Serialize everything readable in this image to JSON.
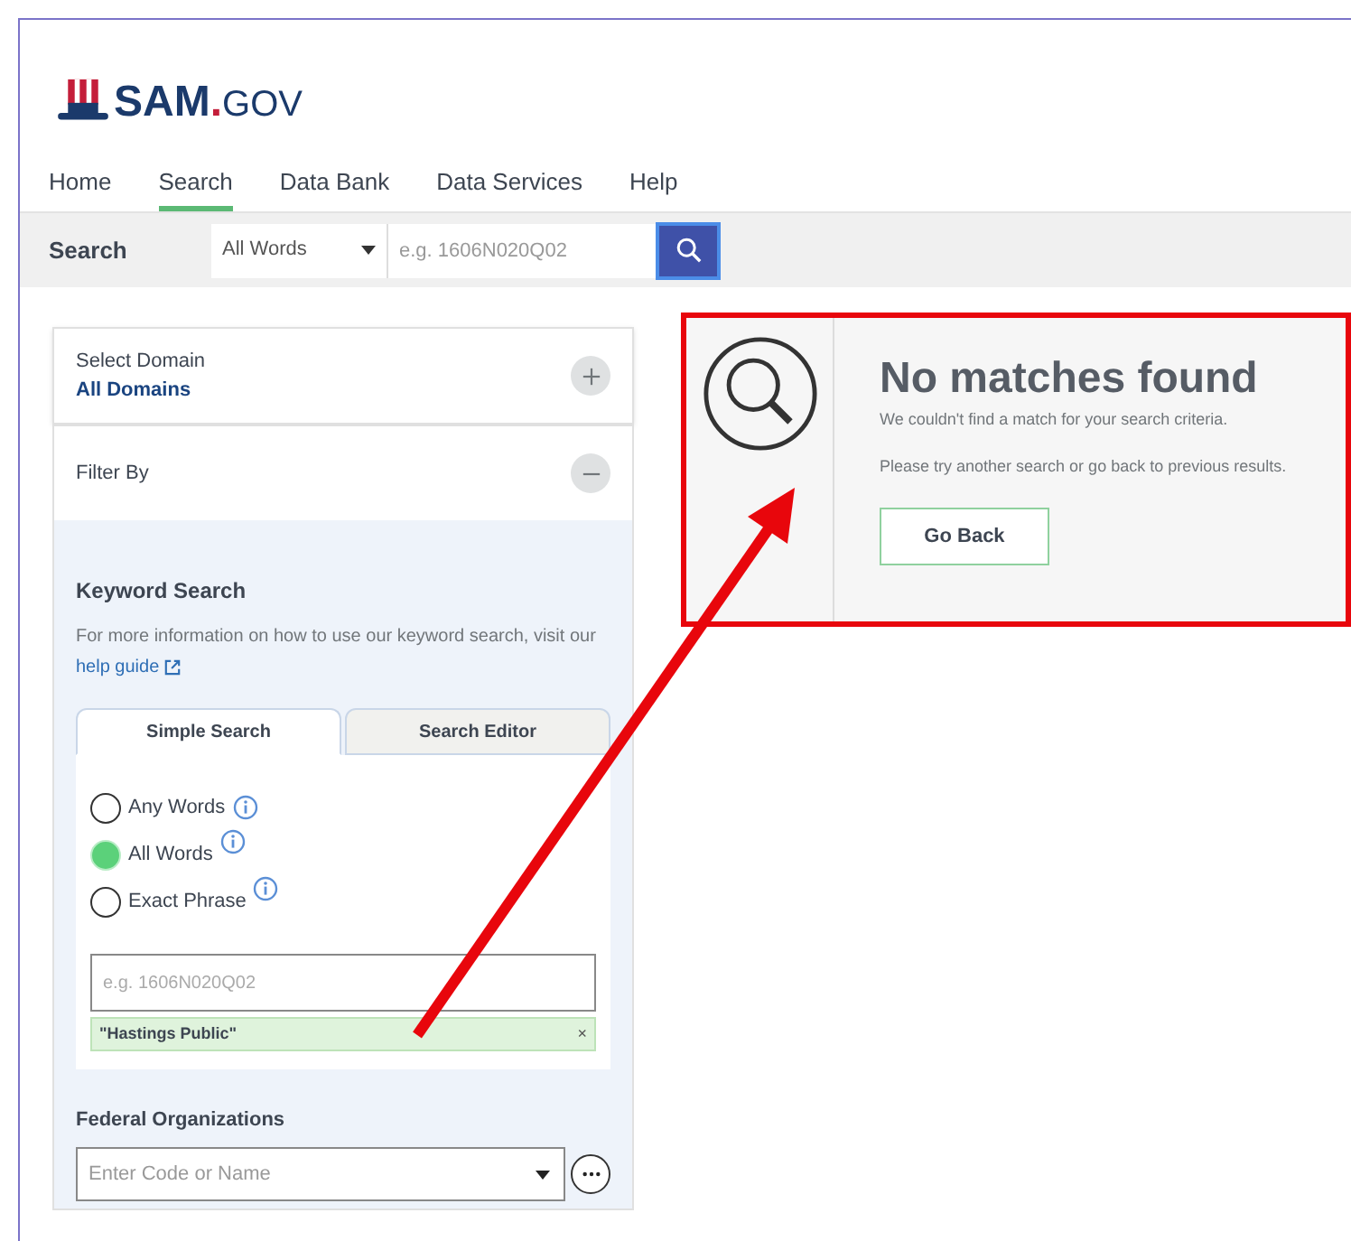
{
  "logo": {
    "name": "SAM",
    "suffix": ".GOV"
  },
  "nav": [
    {
      "label": "Home",
      "selected": false
    },
    {
      "label": "Search",
      "selected": true
    },
    {
      "label": "Data Bank",
      "selected": false
    },
    {
      "label": "Data Services",
      "selected": false
    },
    {
      "label": "Help",
      "selected": false
    }
  ],
  "search_bar": {
    "label": "Search",
    "mode": "All Words",
    "placeholder": "e.g. 1606N020Q02"
  },
  "sidebar": {
    "domain": {
      "label": "Select Domain",
      "value": "All Domains",
      "expanded": false
    },
    "filter": {
      "label": "Filter By",
      "expanded": true
    },
    "keyword": {
      "title": "Keyword Search",
      "info": "For more information on how to use our keyword search, visit our",
      "link": "help guide",
      "tabs": [
        {
          "label": "Simple Search",
          "selected": true
        },
        {
          "label": "Search Editor",
          "selected": false
        }
      ],
      "options": [
        {
          "label": "Any Words",
          "selected": false
        },
        {
          "label": "All Words",
          "selected": true
        },
        {
          "label": "Exact Phrase",
          "selected": false
        }
      ],
      "placeholder": "e.g. 1606N020Q02",
      "chips": [
        {
          "label": "\"Hastings Public\"",
          "remove": "×"
        }
      ]
    },
    "federal_organizations": {
      "title": "Federal Organizations",
      "placeholder": "Enter Code or Name"
    }
  },
  "results": {
    "title": "No matches found",
    "message": "We couldn't find a match for your search criteria.",
    "hint": "Please try another search or go back to previous results.",
    "button": "Go Back"
  }
}
